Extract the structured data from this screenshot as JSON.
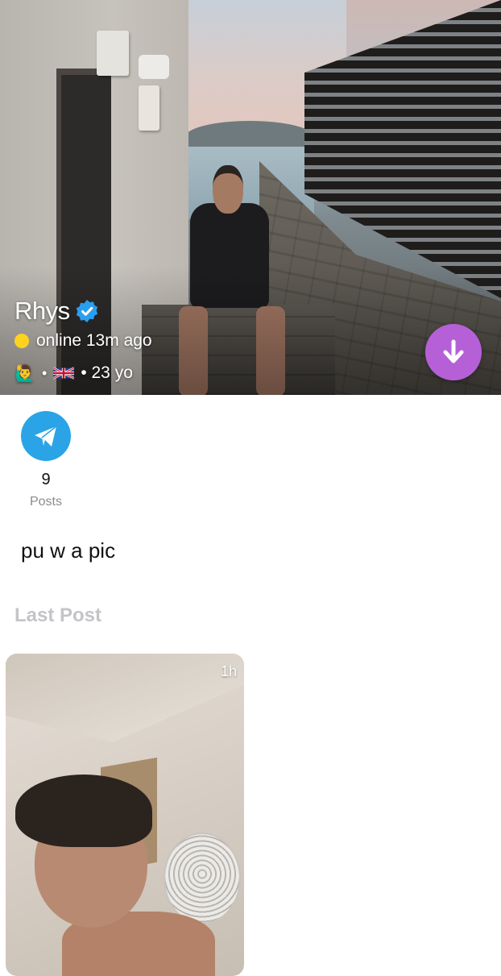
{
  "profile": {
    "name": "Rhys",
    "verified_icon": "verified-badge-icon",
    "status": "online 13m ago",
    "status_color": "#ffd21e",
    "emoji_gender": "🙋‍♂️",
    "flag": "uk-flag-icon",
    "sep": "•",
    "age": "• 23 yo"
  },
  "actions": {
    "download_icon": "arrow-down-icon",
    "download_color": "#b660d8",
    "telegram_icon": "telegram-paper-plane-icon",
    "telegram_color": "#2aa4e6"
  },
  "stats": {
    "posts_count": "9",
    "posts_label": "Posts"
  },
  "bio": "pu w a pic",
  "last_post": {
    "section_label": "Last Post",
    "time": "1h"
  }
}
